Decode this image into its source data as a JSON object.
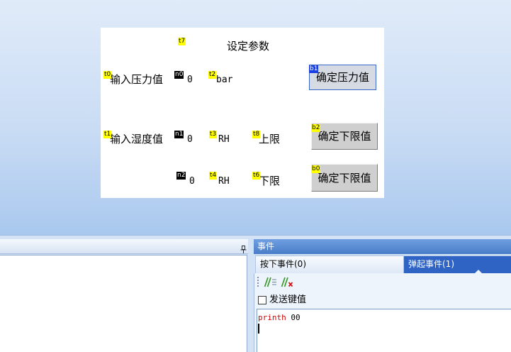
{
  "canvas": {
    "t7": {
      "tag": "t7",
      "text": "设定参数"
    },
    "t0": {
      "tag": "t0",
      "text": "输入压力值"
    },
    "n0": {
      "tag": "n0",
      "value": "0"
    },
    "t2": {
      "tag": "t2",
      "text": "bar"
    },
    "b1": {
      "tag": "b1",
      "text": "确定压力值",
      "selected": true
    },
    "t1": {
      "tag": "t1",
      "text": "输入湿度值"
    },
    "n1": {
      "tag": "n1",
      "value": "0"
    },
    "t3": {
      "tag": "t3",
      "text": "RH"
    },
    "t8": {
      "tag": "t8",
      "text": "上限"
    },
    "b2": {
      "tag": "b2",
      "text": "确定下限值",
      "selected": false
    },
    "n2": {
      "tag": "n2",
      "value": "0"
    },
    "t4": {
      "tag": "t4",
      "text": "RH"
    },
    "t6": {
      "tag": "t6",
      "text": "下限"
    },
    "b0": {
      "tag": "b0",
      "text": "确定下限值",
      "selected": false
    }
  },
  "left_panel": {
    "pin_icon": "pin-icon"
  },
  "event_panel": {
    "title": "事件",
    "tabs": [
      {
        "label": "按下事件(0)",
        "selected": false
      },
      {
        "label": "弹起事件(1)",
        "selected": true
      }
    ],
    "toolbar_icons": [
      "comment-icon",
      "uncomment-icon"
    ],
    "send_key_value": {
      "label": "发送键值",
      "checked": false
    },
    "code_lines": [
      {
        "keyword": "printh",
        "argument": "00"
      }
    ]
  },
  "colors": {
    "tag_text_component": "#ffff00",
    "tag_number_component": "#000000",
    "tag_selected_component": "#1a3fe0",
    "event_header": "#4a7dc8",
    "selected_tab": "#2f63c4",
    "code_keyword": "#d40000"
  }
}
